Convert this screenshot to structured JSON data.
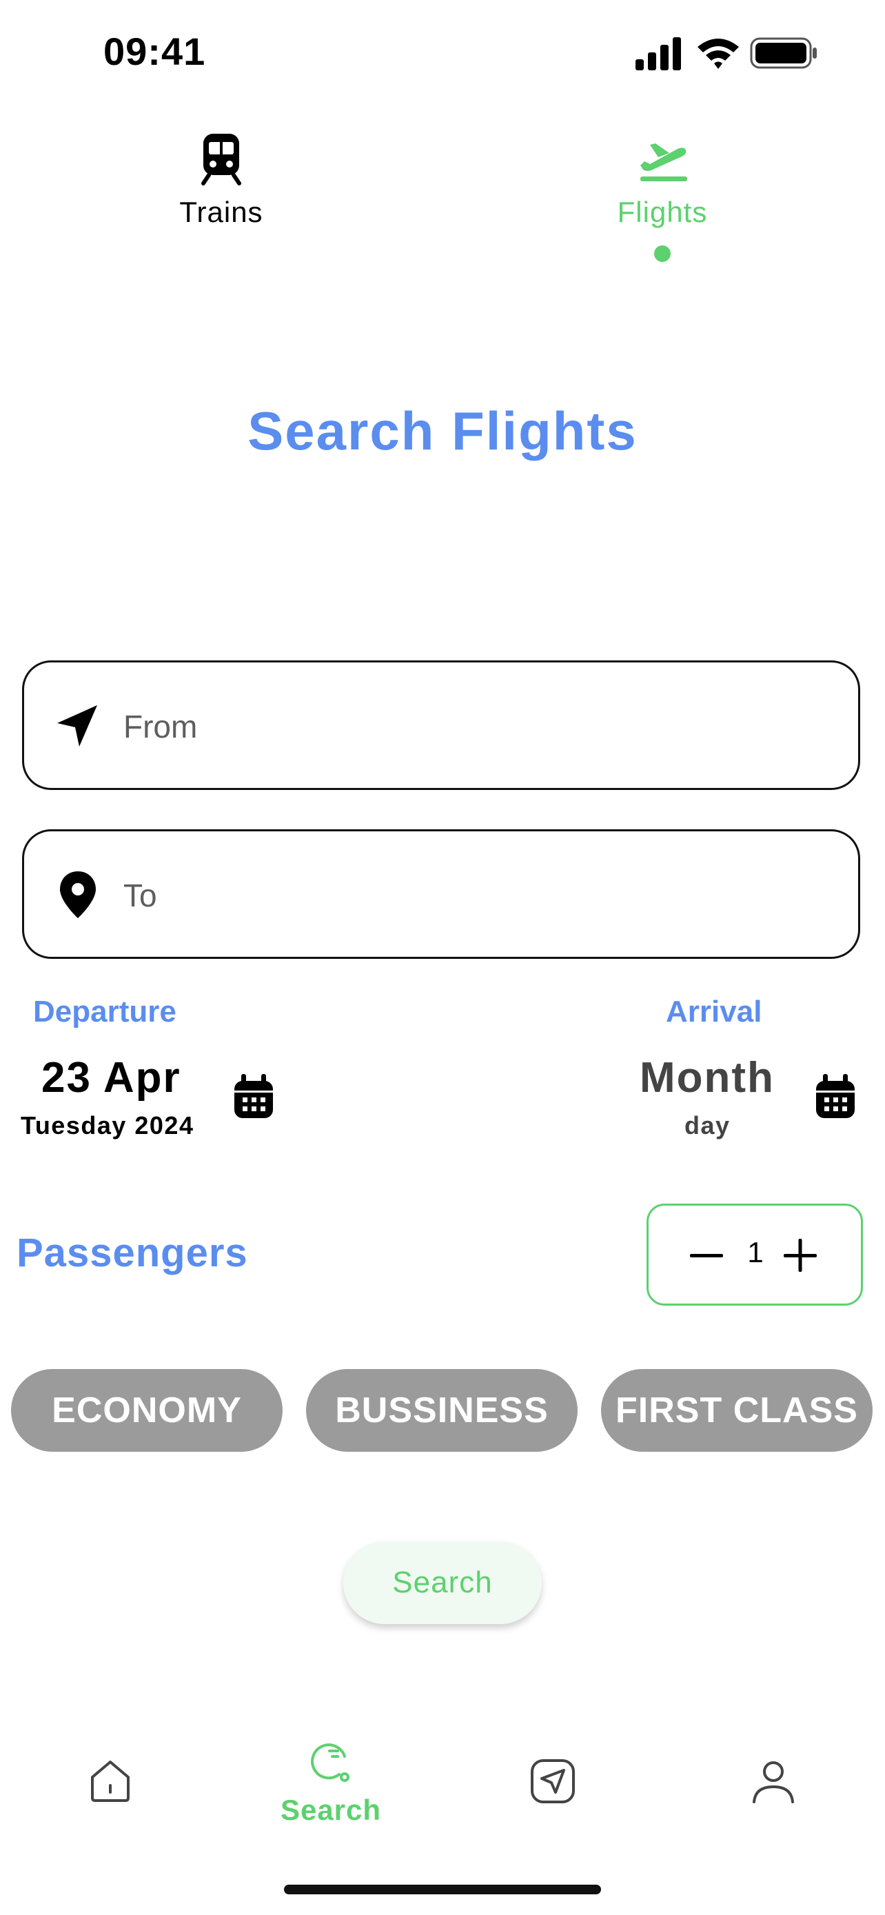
{
  "status_bar": {
    "time": "09:41"
  },
  "mode_tabs": [
    {
      "label": "Trains",
      "icon": "train-icon",
      "active": false
    },
    {
      "label": "Flights",
      "icon": "plane-takeoff-icon",
      "active": true
    }
  ],
  "title": "Search Flights",
  "from_field": {
    "placeholder": "From",
    "value": "",
    "icon": "navigation-arrow-icon"
  },
  "to_field": {
    "placeholder": "To",
    "value": "",
    "icon": "location-pin-icon"
  },
  "departure": {
    "label": "Departure",
    "date": "23 Apr",
    "weekday_year": "Tuesday 2024"
  },
  "arrival": {
    "label": "Arrival",
    "month": "Month",
    "day": "day"
  },
  "passengers": {
    "label": "Passengers",
    "count": "1"
  },
  "class_options": [
    "ECONOMY",
    "BUSSINESS",
    "FIRST CLASS"
  ],
  "search_button": "Search",
  "bottom_nav": [
    {
      "icon": "home-icon",
      "label": ""
    },
    {
      "icon": "search-icon",
      "label": "Search",
      "active": true
    },
    {
      "icon": "navigation-icon",
      "label": ""
    },
    {
      "icon": "profile-icon",
      "label": ""
    }
  ],
  "colors": {
    "accent_blue": "#5b8def",
    "accent_green": "#5cd16e",
    "chip_gray": "#9b9b9b"
  }
}
